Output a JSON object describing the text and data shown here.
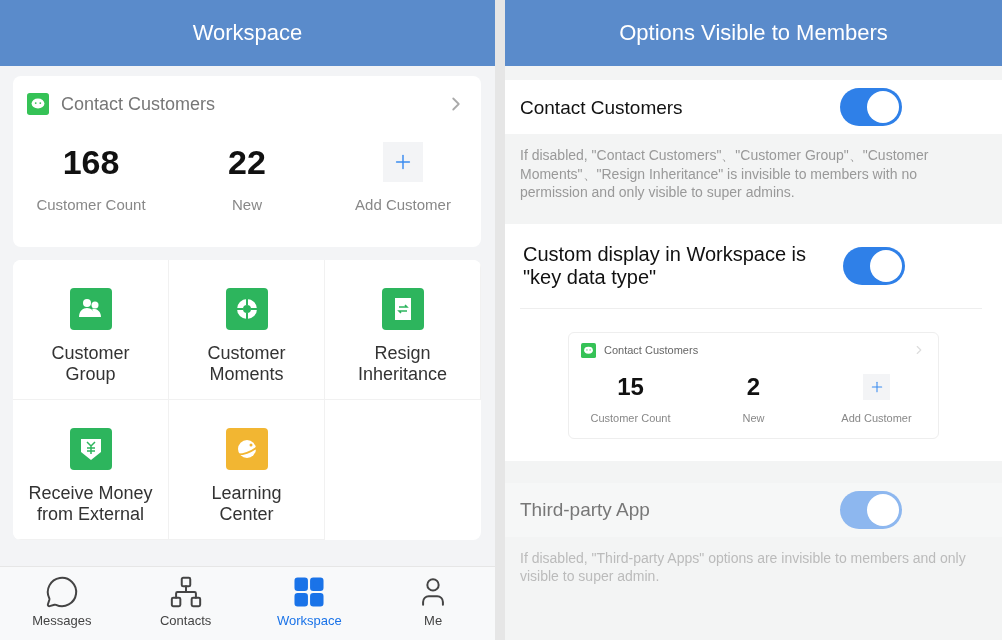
{
  "workspace": {
    "title": "Workspace",
    "card": {
      "title": "Contact Customers",
      "stats": [
        {
          "value": "168",
          "label": "Customer Count"
        },
        {
          "value": "22",
          "label": "New"
        }
      ],
      "add_label": "Add Customer"
    },
    "apps": [
      {
        "label": "Customer Group",
        "kind": "group",
        "color": "#2db55d"
      },
      {
        "label": "Customer Moments",
        "kind": "moments",
        "color": "#2db55d"
      },
      {
        "label": "Resign Inheritance",
        "kind": "inherit",
        "color": "#2db55d"
      },
      {
        "label": "Receive Money from External",
        "kind": "money",
        "color": "#2db55d"
      },
      {
        "label": "Learning Center",
        "kind": "learn",
        "color": "#f2b632"
      }
    ],
    "tab_bar": [
      {
        "label": "Messages",
        "kind": "chat",
        "selected": false
      },
      {
        "label": "Contacts",
        "kind": "org",
        "selected": false
      },
      {
        "label": "Workspace",
        "kind": "grid",
        "selected": true
      },
      {
        "label": "Me",
        "kind": "person",
        "selected": false
      }
    ]
  },
  "options": {
    "title": "Options Visible to Members",
    "settings": [
      {
        "label": "Contact Customers",
        "on": true,
        "disabled": false,
        "note": "If disabled, \"Contact Customers\"、\"Customer Group\"、\"Customer Moments\"、\"Resign Inheritance\" is invisible to members with no permission and only visible to super admins."
      },
      {
        "label": "Custom display in Workspace is \"key data type\"",
        "on": true,
        "disabled": false,
        "preview": {
          "title": "Contact Customers",
          "stats": [
            {
              "value": "15",
              "label": "Customer Count"
            },
            {
              "value": "2",
              "label": "New"
            }
          ],
          "add_label": "Add Customer"
        }
      },
      {
        "label": "Third-party App",
        "on": true,
        "disabled": true,
        "note": "If disabled, \"Third-party Apps\" options are invisible to members and only visible to super admin."
      }
    ]
  }
}
